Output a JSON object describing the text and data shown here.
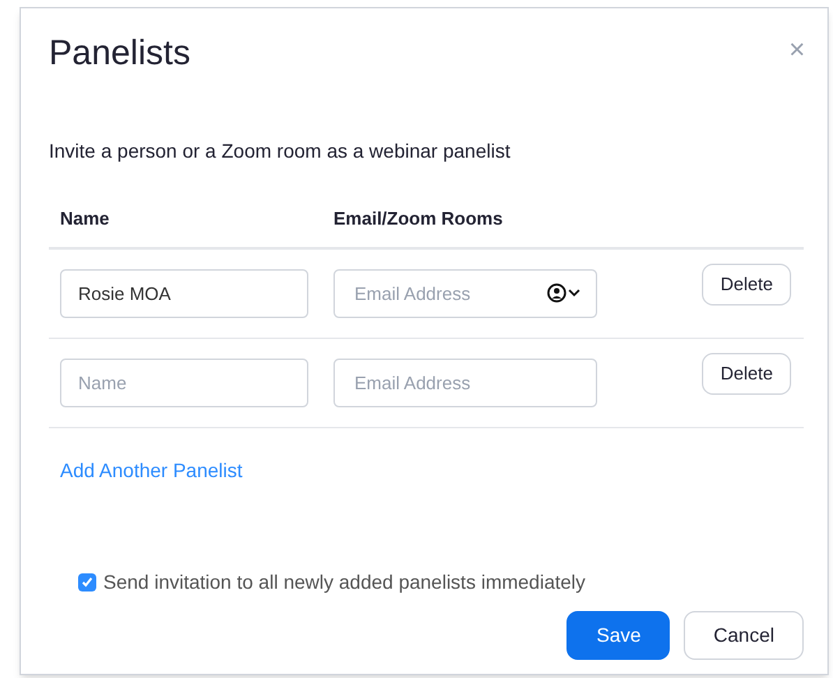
{
  "dialog": {
    "title": "Panelists",
    "close": "×",
    "intro": "Invite a person or a Zoom room as a webinar panelist"
  },
  "columns": [
    "Name",
    "Email/Zoom Rooms"
  ],
  "rows": [
    {
      "name": {
        "value": "Rosie MOA"
      },
      "email": {
        "placeholder": "Email Address"
      },
      "contact_picker": true,
      "delete": "Delete"
    },
    {
      "name": {
        "placeholder": "Name"
      },
      "email": {
        "placeholder": "Email Address"
      },
      "contact_picker": false,
      "delete": "Delete"
    }
  ],
  "add_link": "Add Another Panelist",
  "send_invitation": {
    "label": "Send invitation to all newly added panelists immediately",
    "checked": true
  },
  "buttons": [
    {
      "label": "Save",
      "kind": "primary"
    },
    {
      "label": "Cancel",
      "kind": "secondary"
    }
  ]
}
